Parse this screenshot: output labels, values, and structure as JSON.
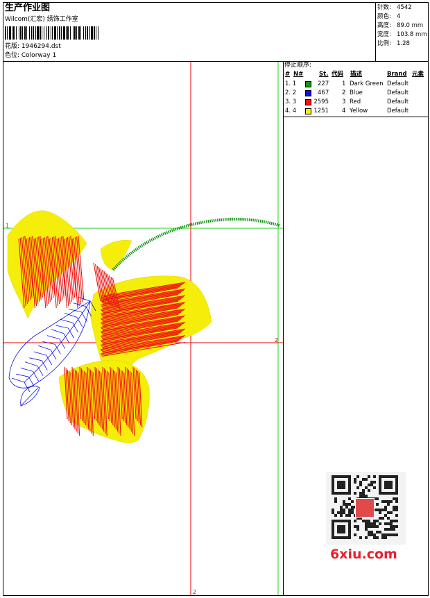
{
  "header": {
    "title": "生产作业图",
    "studio": "Wilcom(汇宏) 绣饰工作室",
    "design_label": "花版: 1946294.dst",
    "color_label": "色位: Colorway 1"
  },
  "stats": [
    {
      "label": "针数:",
      "value": "4542"
    },
    {
      "label": "颜色:",
      "value": "4"
    },
    {
      "label": "高度:",
      "value": "89.0 mm"
    },
    {
      "label": "宽度:",
      "value": "103.8 mm"
    },
    {
      "label": "比例:",
      "value": "1.28"
    }
  ],
  "stop_sequence": {
    "title": "停止顺序:",
    "columns": [
      "#",
      "N#",
      "St.",
      "代码",
      "描述",
      "Brand",
      "元素"
    ],
    "rows": [
      {
        "idx": "1. 1",
        "color": "#129412",
        "stitches": "227",
        "code": "1",
        "desc": "Dark Green",
        "brand": "Default"
      },
      {
        "idx": "2. 2",
        "color": "#0a12e6",
        "stitches": "467",
        "code": "2",
        "desc": "Blue",
        "brand": "Default"
      },
      {
        "idx": "3. 3",
        "color": "#ee1111",
        "stitches": "2595",
        "code": "3",
        "desc": "Red",
        "brand": "Default"
      },
      {
        "idx": "4. 4",
        "color": "#f4ee0a",
        "stitches": "1251",
        "code": "4",
        "desc": "Yellow",
        "brand": "Default"
      }
    ]
  },
  "markers": {
    "h1": "1",
    "h2": "2",
    "v2": "2"
  },
  "watermark": {
    "site": "6xiu.com"
  },
  "colors": {
    "green_guide": "#22cc22",
    "red_guide": "#ee0000"
  }
}
